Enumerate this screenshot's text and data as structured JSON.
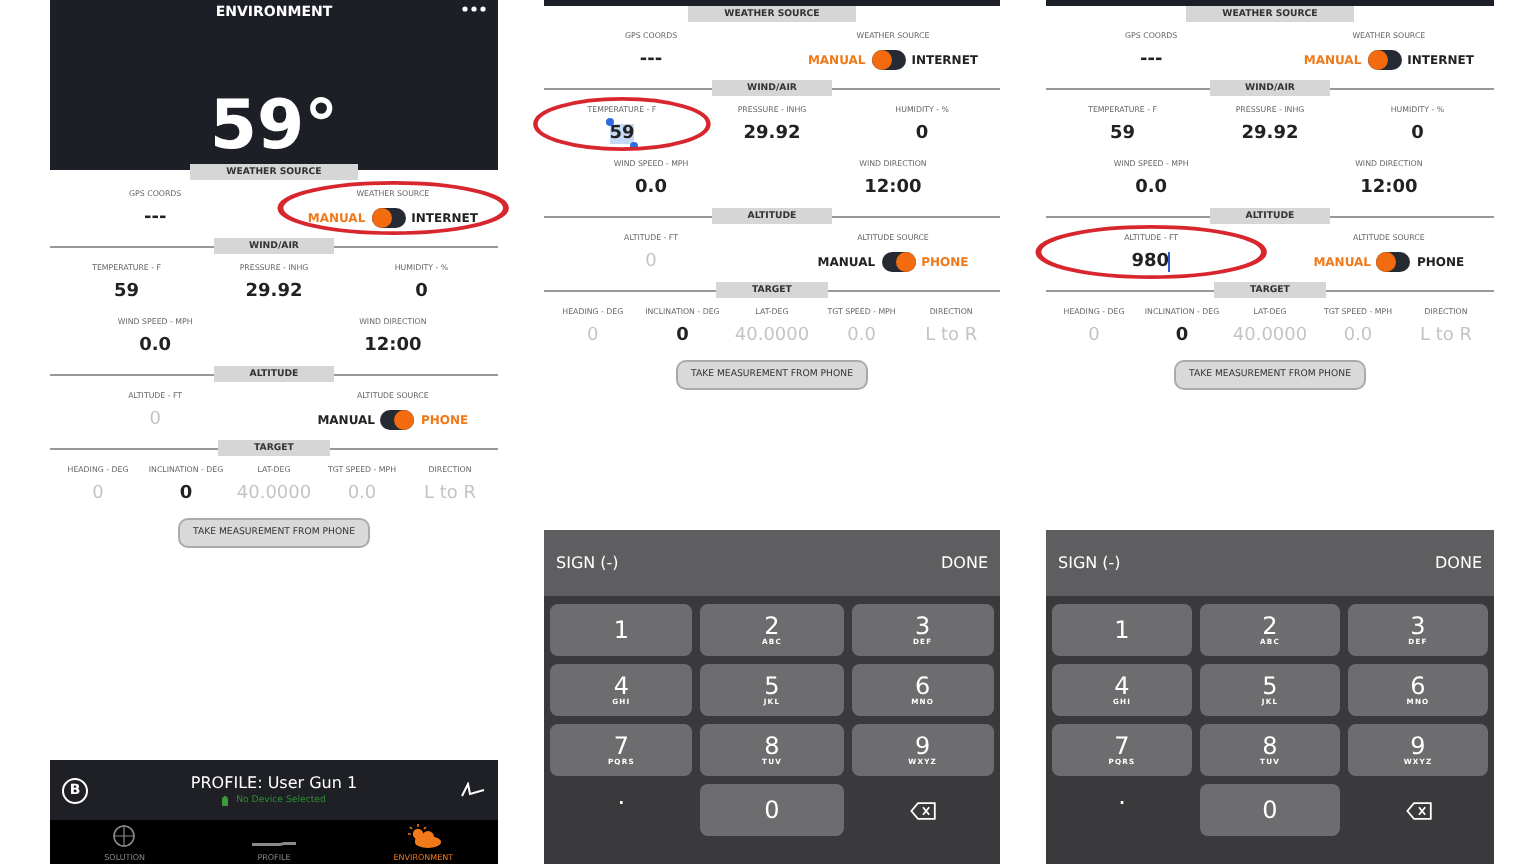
{
  "panels": [
    {
      "header": {
        "title": "ENVIRONMENT",
        "reading": "59°"
      },
      "sections": [
        {
          "title": "WEATHER SOURCE",
          "rows": [
            [
              {
                "kind": "value",
                "label": "GPS COORDS",
                "value": "---",
                "muted": false
              },
              {
                "kind": "toggle",
                "label": "WEATHER SOURCE",
                "circled": true,
                "options": [
                  {
                    "label": "MANUAL",
                    "selected": true
                  },
                  {
                    "label": "INTERNET",
                    "selected": false
                  }
                ]
              }
            ]
          ]
        },
        {
          "title": "WIND/AIR",
          "rows": [
            [
              {
                "kind": "value",
                "label": "TEMPERATURE - F",
                "value": "59",
                "muted": false
              },
              {
                "kind": "value",
                "label": "PRESSURE - INHG",
                "value": "29.92",
                "muted": false
              },
              {
                "kind": "value",
                "label": "HUMIDITY - %",
                "value": "0",
                "muted": false
              }
            ],
            [
              {
                "kind": "value",
                "label": "WIND SPEED - MPH",
                "value": "0.0",
                "muted": false
              },
              {
                "kind": "value",
                "label": "WIND DIRECTION",
                "value": "12:00",
                "muted": false
              }
            ]
          ]
        },
        {
          "title": "ALTITUDE",
          "rows": [
            [
              {
                "kind": "value",
                "label": "ALTITUDE - FT",
                "value": "0",
                "muted": true
              },
              {
                "kind": "toggle",
                "label": "ALTITUDE SOURCE",
                "options": [
                  {
                    "label": "MANUAL",
                    "selected": false
                  },
                  {
                    "label": "PHONE",
                    "selected": true
                  }
                ]
              }
            ]
          ]
        },
        {
          "title": "TARGET",
          "rows": [
            [
              {
                "kind": "value",
                "label": "HEADING - DEG",
                "value": "0",
                "muted": true
              },
              {
                "kind": "value",
                "label": "INCLINATION - DEG",
                "value": "0",
                "muted": false
              },
              {
                "kind": "value",
                "label": "LAT-DEG",
                "value": "40.0000",
                "muted": true
              },
              {
                "kind": "value",
                "label": "TGT SPEED - MPH",
                "value": "0.0",
                "muted": true
              },
              {
                "kind": "value",
                "label": "DIRECTION",
                "value": "L to R",
                "muted": true
              }
            ]
          ]
        }
      ],
      "action": "TAKE MEASUREMENT FROM PHONE",
      "footer": {
        "badge": "B",
        "profile": "PROFILE: User Gun 1",
        "device": "No Device Selected",
        "tabs": [
          {
            "label": "SOLUTION",
            "selected": false
          },
          {
            "label": "PROFILE",
            "selected": false
          },
          {
            "label": "ENVIRONMENT",
            "selected": true
          }
        ]
      }
    },
    {
      "sections": [
        {
          "title": "WEATHER SOURCE",
          "rows": [
            [
              {
                "kind": "value",
                "label": "GPS COORDS",
                "value": "---",
                "muted": false
              },
              {
                "kind": "toggle",
                "label": "WEATHER SOURCE",
                "options": [
                  {
                    "label": "MANUAL",
                    "selected": true
                  },
                  {
                    "label": "INTERNET",
                    "selected": false
                  }
                ]
              }
            ]
          ]
        },
        {
          "title": "WIND/AIR",
          "rows": [
            [
              {
                "kind": "value",
                "label": "TEMPERATURE - F",
                "value": "59",
                "muted": false,
                "circled": true,
                "highlighted": true
              },
              {
                "kind": "value",
                "label": "PRESSURE - INHG",
                "value": "29.92",
                "muted": false
              },
              {
                "kind": "value",
                "label": "HUMIDITY - %",
                "value": "0",
                "muted": false
              }
            ],
            [
              {
                "kind": "value",
                "label": "WIND SPEED - MPH",
                "value": "0.0",
                "muted": false
              },
              {
                "kind": "value",
                "label": "WIND DIRECTION",
                "value": "12:00",
                "muted": false
              }
            ]
          ]
        },
        {
          "title": "ALTITUDE",
          "rows": [
            [
              {
                "kind": "value",
                "label": "ALTITUDE - FT",
                "value": "0",
                "muted": true
              },
              {
                "kind": "toggle",
                "label": "ALTITUDE SOURCE",
                "options": [
                  {
                    "label": "MANUAL",
                    "selected": false
                  },
                  {
                    "label": "PHONE",
                    "selected": true
                  }
                ]
              }
            ]
          ]
        },
        {
          "title": "TARGET",
          "rows": [
            [
              {
                "kind": "value",
                "label": "HEADING - DEG",
                "value": "0",
                "muted": true
              },
              {
                "kind": "value",
                "label": "INCLINATION - DEG",
                "value": "0",
                "muted": false
              },
              {
                "kind": "value",
                "label": "LAT-DEG",
                "value": "40.0000",
                "muted": true
              },
              {
                "kind": "value",
                "label": "TGT SPEED - MPH",
                "value": "0.0",
                "muted": true
              },
              {
                "kind": "value",
                "label": "DIRECTION",
                "value": "L to R",
                "muted": true
              }
            ]
          ]
        }
      ],
      "action": "TAKE MEASUREMENT FROM PHONE",
      "keypad": {
        "left": "SIGN (-)",
        "right": "DONE",
        "keys": [
          {
            "kind": "digit",
            "digit": "1"
          },
          {
            "kind": "digit",
            "digit": "2",
            "letters": "ABC"
          },
          {
            "kind": "digit",
            "digit": "3",
            "letters": "DEF"
          },
          {
            "kind": "digit",
            "digit": "4",
            "letters": "GHI"
          },
          {
            "kind": "digit",
            "digit": "5",
            "letters": "JKL"
          },
          {
            "kind": "digit",
            "digit": "6",
            "letters": "MNO"
          },
          {
            "kind": "digit",
            "digit": "7",
            "letters": "PQRS"
          },
          {
            "kind": "digit",
            "digit": "8",
            "letters": "TUV"
          },
          {
            "kind": "digit",
            "digit": "9",
            "letters": "WXYZ"
          },
          {
            "kind": "plain",
            "digit": "."
          },
          {
            "kind": "digit",
            "digit": "0"
          },
          {
            "kind": "backspace"
          }
        ]
      }
    },
    {
      "sections": [
        {
          "title": "WEATHER SOURCE",
          "rows": [
            [
              {
                "kind": "value",
                "label": "GPS COORDS",
                "value": "---",
                "muted": false
              },
              {
                "kind": "toggle",
                "label": "WEATHER SOURCE",
                "options": [
                  {
                    "label": "MANUAL",
                    "selected": true
                  },
                  {
                    "label": "INTERNET",
                    "selected": false
                  }
                ]
              }
            ]
          ]
        },
        {
          "title": "WIND/AIR",
          "rows": [
            [
              {
                "kind": "value",
                "label": "TEMPERATURE - F",
                "value": "59",
                "muted": false
              },
              {
                "kind": "value",
                "label": "PRESSURE - INHG",
                "value": "29.92",
                "muted": false
              },
              {
                "kind": "value",
                "label": "HUMIDITY - %",
                "value": "0",
                "muted": false
              }
            ],
            [
              {
                "kind": "value",
                "label": "WIND SPEED - MPH",
                "value": "0.0",
                "muted": false
              },
              {
                "kind": "value",
                "label": "WIND DIRECTION",
                "value": "12:00",
                "muted": false
              }
            ]
          ]
        },
        {
          "title": "ALTITUDE",
          "rows": [
            [
              {
                "kind": "value",
                "label": "ALTITUDE - FT",
                "value": "980",
                "muted": false,
                "circled": true,
                "cursor": true
              },
              {
                "kind": "toggle",
                "label": "ALTITUDE SOURCE",
                "options": [
                  {
                    "label": "MANUAL",
                    "selected": true
                  },
                  {
                    "label": "PHONE",
                    "selected": false
                  }
                ]
              }
            ]
          ]
        },
        {
          "title": "TARGET",
          "rows": [
            [
              {
                "kind": "value",
                "label": "HEADING - DEG",
                "value": "0",
                "muted": true
              },
              {
                "kind": "value",
                "label": "INCLINATION - DEG",
                "value": "0",
                "muted": false
              },
              {
                "kind": "value",
                "label": "LAT-DEG",
                "value": "40.0000",
                "muted": true
              },
              {
                "kind": "value",
                "label": "TGT SPEED - MPH",
                "value": "0.0",
                "muted": true
              },
              {
                "kind": "value",
                "label": "DIRECTION",
                "value": "L to R",
                "muted": true
              }
            ]
          ]
        }
      ],
      "action": "TAKE MEASUREMENT FROM PHONE",
      "keypad": {
        "left": "SIGN (-)",
        "right": "DONE",
        "keys": [
          {
            "kind": "digit",
            "digit": "1"
          },
          {
            "kind": "digit",
            "digit": "2",
            "letters": "ABC"
          },
          {
            "kind": "digit",
            "digit": "3",
            "letters": "DEF"
          },
          {
            "kind": "digit",
            "digit": "4",
            "letters": "GHI"
          },
          {
            "kind": "digit",
            "digit": "5",
            "letters": "JKL"
          },
          {
            "kind": "digit",
            "digit": "6",
            "letters": "MNO"
          },
          {
            "kind": "digit",
            "digit": "7",
            "letters": "PQRS"
          },
          {
            "kind": "digit",
            "digit": "8",
            "letters": "TUV"
          },
          {
            "kind": "digit",
            "digit": "9",
            "letters": "WXYZ"
          },
          {
            "kind": "plain",
            "digit": "."
          },
          {
            "kind": "digit",
            "digit": "0"
          },
          {
            "kind": "backspace"
          }
        ]
      }
    }
  ]
}
